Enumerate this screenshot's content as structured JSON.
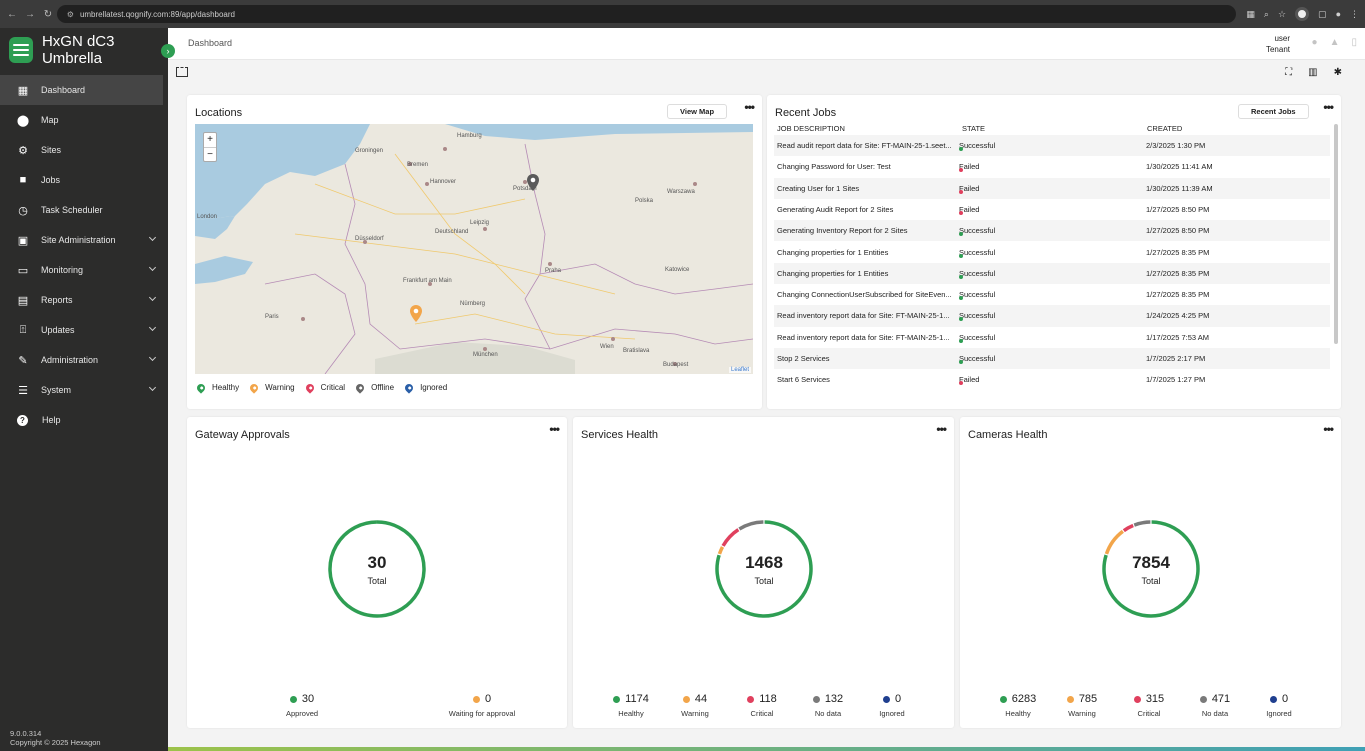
{
  "browser": {
    "url": "umbrellatest.qognify.com:89/app/dashboard"
  },
  "app": {
    "name": "HxGN dC3 Umbrella",
    "version": "9.0.0.314",
    "copyright": "Copyright © 2025 Hexagon"
  },
  "header": {
    "title": "Dashboard",
    "user": "user",
    "tenant": "Tenant"
  },
  "sidebar": {
    "items": [
      {
        "label": "Dashboard",
        "icon": "dashboard-icon",
        "active": true,
        "expandable": false
      },
      {
        "label": "Map",
        "icon": "map-pin-icon",
        "active": false,
        "expandable": false
      },
      {
        "label": "Sites",
        "icon": "sites-icon",
        "active": false,
        "expandable": false
      },
      {
        "label": "Jobs",
        "icon": "briefcase-icon",
        "active": false,
        "expandable": false
      },
      {
        "label": "Task Scheduler",
        "icon": "clock-icon",
        "active": false,
        "expandable": false
      },
      {
        "label": "Site Administration",
        "icon": "site-admin-icon",
        "active": false,
        "expandable": true
      },
      {
        "label": "Monitoring",
        "icon": "monitor-icon",
        "active": false,
        "expandable": true
      },
      {
        "label": "Reports",
        "icon": "reports-icon",
        "active": false,
        "expandable": true
      },
      {
        "label": "Updates",
        "icon": "updates-icon",
        "active": false,
        "expandable": true
      },
      {
        "label": "Administration",
        "icon": "wrench-icon",
        "active": false,
        "expandable": true
      },
      {
        "label": "System",
        "icon": "system-icon",
        "active": false,
        "expandable": true
      },
      {
        "label": "Help",
        "icon": "help-icon",
        "active": false,
        "expandable": false
      }
    ]
  },
  "locations": {
    "title": "Locations",
    "button": "View Map",
    "attribution": "Leaflet",
    "legend": [
      {
        "label": "Healthy",
        "color": "#2e9e53"
      },
      {
        "label": "Warning",
        "color": "#f2a54a"
      },
      {
        "label": "Critical",
        "color": "#e0405e"
      },
      {
        "label": "Offline",
        "color": "#666666"
      },
      {
        "label": "Ignored",
        "color": "#2a5fa8"
      }
    ],
    "cities": [
      "Hamburg",
      "Bremen",
      "Groningen",
      "Hannover",
      "Potsdam",
      "Warszawa",
      "Leipzig",
      "Düsseldorf",
      "Deutschland",
      "Frankfurt am Main",
      "Praha",
      "Nürnberg",
      "Paris",
      "Wien",
      "München",
      "Budapest",
      "Bratislava",
      "London",
      "Katowice",
      "Polska"
    ]
  },
  "recent_jobs": {
    "title": "Recent Jobs",
    "button": "Recent Jobs",
    "columns": [
      "JOB DESCRIPTION",
      "STATE",
      "CREATED"
    ],
    "rows": [
      {
        "description": "Read audit report data for Site: FT-MAIN-25-1.seet...",
        "state": "Successful",
        "created": "2/3/2025 1:30 PM"
      },
      {
        "description": "Changing Password for User: Test",
        "state": "Failed",
        "created": "1/30/2025 11:41 AM"
      },
      {
        "description": "Creating User for 1 Sites",
        "state": "Failed",
        "created": "1/30/2025 11:39 AM"
      },
      {
        "description": "Generating Audit Report for 2 Sites",
        "state": "Failed",
        "created": "1/27/2025 8:50 PM"
      },
      {
        "description": "Generating Inventory Report for 2 Sites",
        "state": "Successful",
        "created": "1/27/2025 8:50 PM"
      },
      {
        "description": "Changing properties for 1 Entities",
        "state": "Successful",
        "created": "1/27/2025 8:35 PM"
      },
      {
        "description": "Changing properties for 1 Entities",
        "state": "Successful",
        "created": "1/27/2025 8:35 PM"
      },
      {
        "description": "Changing ConnectionUserSubscribed for SiteEven...",
        "state": "Successful",
        "created": "1/27/2025 8:35 PM"
      },
      {
        "description": "Read inventory report data for Site: FT-MAIN-25-1...",
        "state": "Successful",
        "created": "1/24/2025 4:25 PM"
      },
      {
        "description": "Read inventory report data for Site: FT-MAIN-25-1...",
        "state": "Successful",
        "created": "1/17/2025 7:53 AM"
      },
      {
        "description": "Stop 2 Services",
        "state": "Successful",
        "created": "1/7/2025 2:17 PM"
      },
      {
        "description": "Start 6 Services",
        "state": "Failed",
        "created": "1/7/2025 1:27 PM"
      }
    ],
    "state_colors": {
      "Successful": "#2e9e53",
      "Failed": "#e0405e"
    }
  },
  "gateway": {
    "title": "Gateway Approvals",
    "total": "30",
    "total_label": "Total",
    "stats": [
      {
        "value": "30",
        "label": "Approved",
        "color": "#2e9e53",
        "count": 30
      },
      {
        "value": "0",
        "label": "Waiting for approval",
        "color": "#f2a54a",
        "count": 0
      }
    ]
  },
  "services": {
    "title": "Services Health",
    "total": "1468",
    "total_label": "Total",
    "stats": [
      {
        "value": "1174",
        "label": "Healthy",
        "color": "#2e9e53",
        "count": 1174
      },
      {
        "value": "44",
        "label": "Warning",
        "color": "#f2a54a",
        "count": 44
      },
      {
        "value": "118",
        "label": "Critical",
        "color": "#e0405e",
        "count": 118
      },
      {
        "value": "132",
        "label": "No data",
        "color": "#7a7a7a",
        "count": 132
      },
      {
        "value": "0",
        "label": "Ignored",
        "color": "#1f3f8f",
        "count": 0
      }
    ]
  },
  "cameras": {
    "title": "Cameras Health",
    "total": "7854",
    "total_label": "Total",
    "stats": [
      {
        "value": "6283",
        "label": "Healthy",
        "color": "#2e9e53",
        "count": 6283
      },
      {
        "value": "785",
        "label": "Warning",
        "color": "#f2a54a",
        "count": 785
      },
      {
        "value": "315",
        "label": "Critical",
        "color": "#e0405e",
        "count": 315
      },
      {
        "value": "471",
        "label": "No data",
        "color": "#7a7a7a",
        "count": 471
      },
      {
        "value": "0",
        "label": "Ignored",
        "color": "#1f3f8f",
        "count": 0
      }
    ]
  }
}
